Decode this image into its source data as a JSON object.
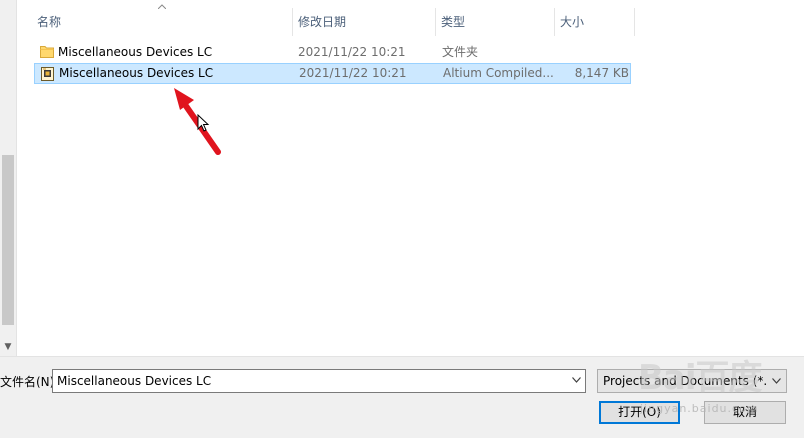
{
  "columns": {
    "name": "名称",
    "modified": "修改日期",
    "type": "类型",
    "size": "大小"
  },
  "files": [
    {
      "name": "Miscellaneous Devices LC",
      "modified": "2021/11/22 10:21",
      "type": "文件夹",
      "size": "",
      "icon": "folder-icon",
      "selected": false
    },
    {
      "name": "Miscellaneous Devices LC",
      "modified": "2021/11/22 10:21",
      "type": "Altium Compiled...",
      "size": "8,147 KB",
      "icon": "altium-file-icon",
      "selected": true
    }
  ],
  "bottom": {
    "filename_label": "文件名(N):",
    "filename_value": "Miscellaneous Devices LC",
    "filter_value": "Projects and Documents (*.D",
    "open_label": "打开(O)",
    "cancel_label": "取消"
  },
  "watermark": {
    "logo": "Bai百度",
    "text": "jingyan.baidu.com"
  },
  "colors": {
    "selection_bg": "#cce8ff",
    "selection_border": "#99d1ff",
    "header_text": "#4c607a",
    "annotation_arrow": "#e0141e"
  }
}
